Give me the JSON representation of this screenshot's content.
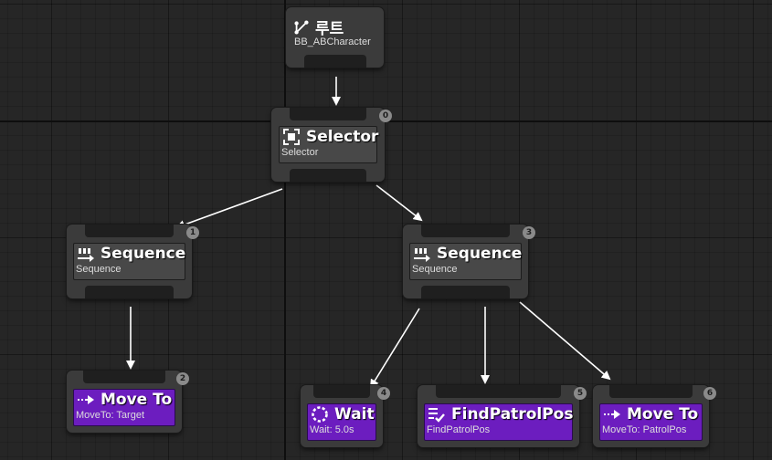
{
  "root": {
    "title": "루트",
    "subtitle": "BB_ABCharacter",
    "icon": "root-branch-icon"
  },
  "nodes": {
    "selector": {
      "title": "Selector",
      "subtitle": "Selector",
      "index": "0",
      "icon": "selector-icon"
    },
    "sequence_left": {
      "title": "Sequence",
      "subtitle": "Sequence",
      "index": "1",
      "icon": "sequence-icon"
    },
    "move_to_target": {
      "title": "Move To",
      "subtitle": "MoveTo: Target",
      "index": "2",
      "icon": "move-to-icon"
    },
    "sequence_right": {
      "title": "Sequence",
      "subtitle": "Sequence",
      "index": "3",
      "icon": "sequence-icon"
    },
    "wait": {
      "title": "Wait",
      "subtitle": "Wait: 5.0s",
      "index": "4",
      "icon": "wait-icon"
    },
    "find_patrol_pos": {
      "title": "FindPatrolPos",
      "subtitle": "FindPatrolPos",
      "index": "5",
      "icon": "task-icon"
    },
    "move_to_patrol": {
      "title": "Move To",
      "subtitle": "MoveTo: PatrolPos",
      "index": "6",
      "icon": "move-to-icon"
    }
  },
  "colors": {
    "composite_panel": "#484848",
    "task_panel": "#6c1dbf",
    "node_body": "#3b3b3b",
    "canvas": "#262626",
    "link": "#ffffff"
  }
}
